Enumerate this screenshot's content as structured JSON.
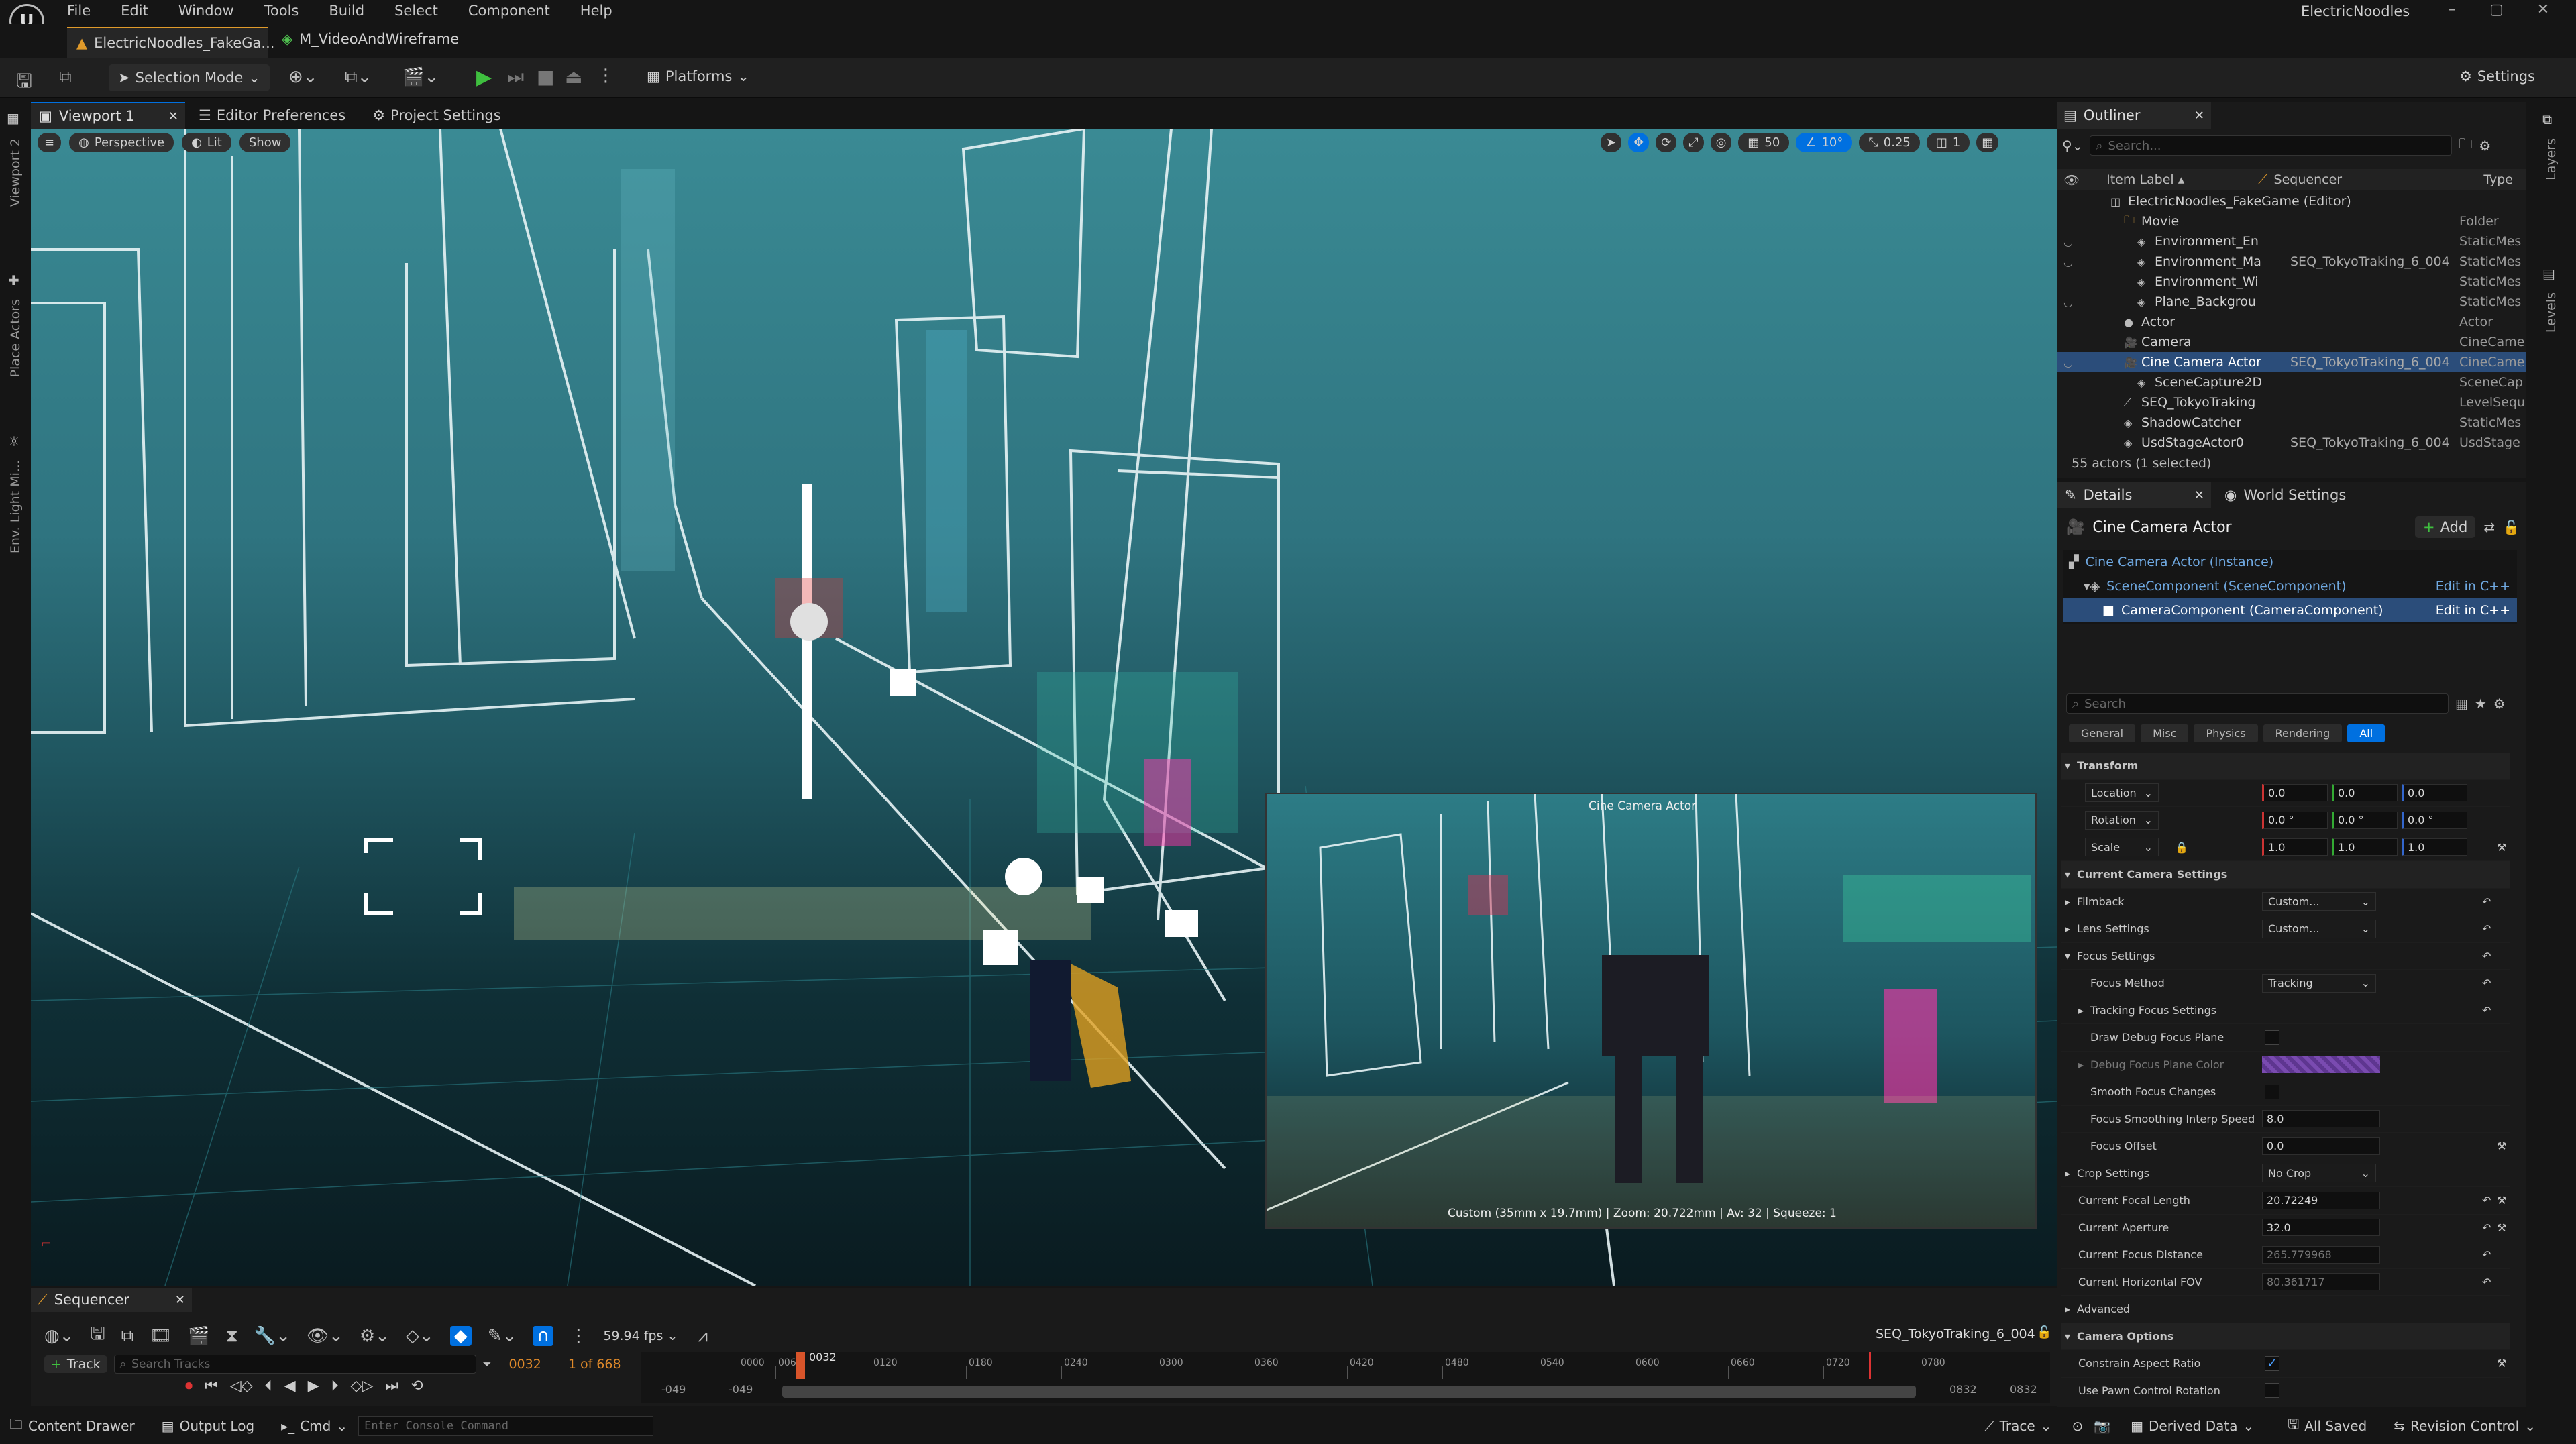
{
  "menu": [
    "File",
    "Edit",
    "Window",
    "Tools",
    "Build",
    "Select",
    "Component",
    "Help"
  ],
  "project_name": "ElectricNoodles",
  "tabs": [
    {
      "label": "ElectricNoodles_FakeGa..."
    },
    {
      "label": "M_VideoAndWireframe"
    }
  ],
  "toolbar": {
    "selection_mode": "Selection Mode",
    "platforms": "Platforms",
    "settings": "Settings"
  },
  "viewport_tabs": {
    "viewport": "Viewport 1",
    "editor_prefs": "Editor Preferences",
    "project_settings": "Project Settings"
  },
  "left_strip": {
    "viewport2": "Viewport 2",
    "place_actors": "Place Actors",
    "env_light": "Env. Light Mi..."
  },
  "right_strip": {
    "layers": "Layers",
    "levels": "Levels"
  },
  "viewport": {
    "perspective": "Perspective",
    "lit": "Lit",
    "show": "Show",
    "grid_snap": "50",
    "angle_snap": "10°",
    "scale_snap": "0.25",
    "camera_speed": "1",
    "pip_title": "Cine Camera Actor",
    "pip_footer": "Custom (35mm x 19.7mm) | Zoom: 20.722mm | Av: 32 | Squeeze: 1"
  },
  "outliner": {
    "title": "Outliner",
    "search_placeholder": "Search...",
    "col_label": "Item Label",
    "col_seq": "Sequencer",
    "col_type": "Type",
    "rows": [
      {
        "label": "ElectricNoodles_FakeGame (Editor)",
        "seq": "",
        "type": ""
      },
      {
        "label": "Movie",
        "seq": "",
        "type": "Folder"
      },
      {
        "label": "Environment_En",
        "seq": "",
        "type": "StaticMes"
      },
      {
        "label": "Environment_Ma",
        "seq": "SEQ_TokyoTraking_6_004",
        "type": "StaticMes"
      },
      {
        "label": "Environment_Wi",
        "seq": "",
        "type": "StaticMes"
      },
      {
        "label": "Plane_Backgrou",
        "seq": "",
        "type": "StaticMes"
      },
      {
        "label": "Actor",
        "seq": "",
        "type": "Actor"
      },
      {
        "label": "Camera",
        "seq": "",
        "type": "CineCame"
      },
      {
        "label": "Cine Camera Actor",
        "seq": "SEQ_TokyoTraking_6_004",
        "type": "CineCame"
      },
      {
        "label": "SceneCapture2D",
        "seq": "",
        "type": "SceneCap"
      },
      {
        "label": "SEQ_TokyoTraking",
        "seq": "",
        "type": "LevelSequ"
      },
      {
        "label": "ShadowCatcher",
        "seq": "",
        "type": "StaticMes"
      },
      {
        "label": "UsdStageActor0",
        "seq": "SEQ_TokyoTraking_6_004",
        "type": "UsdStage"
      }
    ],
    "status": "55 actors (1 selected)"
  },
  "details": {
    "tab": "Details",
    "world_tab": "World Settings",
    "actor_name": "Cine Camera Actor",
    "add": "Add",
    "instance": "Cine Camera Actor (Instance)",
    "scene_comp": "SceneComponent (SceneComponent)",
    "camera_comp": "CameraComponent (CameraComponent)",
    "edit_cpp": "Edit in C++",
    "search_placeholder": "Search",
    "filters": [
      "General",
      "Misc",
      "Physics",
      "Rendering",
      "All"
    ],
    "transform": "Transform",
    "location": "Location",
    "rotation": "Rotation",
    "scale": "Scale",
    "loc": [
      "0.0",
      "0.0",
      "0.0"
    ],
    "rot": [
      "0.0 °",
      "0.0 °",
      "0.0 °"
    ],
    "scl": [
      "1.0",
      "1.0",
      "1.0"
    ],
    "current_camera_settings": "Current Camera Settings",
    "filmback": "Filmback",
    "filmback_val": "Custom...",
    "lens": "Lens Settings",
    "lens_val": "Custom...",
    "focus": "Focus Settings",
    "focus_method": "Focus Method",
    "focus_method_val": "Tracking",
    "tracking_focus": "Tracking Focus Settings",
    "draw_debug": "Draw Debug Focus Plane",
    "debug_color": "Debug Focus Plane Color",
    "smooth": "Smooth Focus Changes",
    "smooth_speed": "Focus Smoothing Interp Speed",
    "smooth_speed_val": "8.0",
    "focus_offset": "Focus Offset",
    "focus_offset_val": "0.0",
    "crop": "Crop Settings",
    "crop_val": "No Crop",
    "focal_length": "Current Focal Length",
    "focal_length_val": "20.72249",
    "aperture": "Current Aperture",
    "aperture_val": "32.0",
    "focus_distance": "Current Focus Distance",
    "focus_distance_val": "265.779968",
    "hfov": "Current Horizontal FOV",
    "hfov_val": "80.361717",
    "advanced": "Advanced",
    "camera_options": "Camera Options",
    "constrain": "Constrain Aspect Ratio",
    "pawn_rot": "Use Pawn Control Rotation"
  },
  "sequencer": {
    "title": "Sequencer",
    "fps": "59.94 fps",
    "sequence_name": "SEQ_TokyoTraking_6_004",
    "track": "Track",
    "search_placeholder": "Search Tracks",
    "current_frame": "0032",
    "frame_count": "1 of 668",
    "playhead": "0032",
    "ticks": [
      "0060",
      "0120",
      "0180",
      "0240",
      "0300",
      "0360",
      "0420",
      "0480",
      "0540",
      "0600",
      "0660",
      "0720",
      "0780"
    ],
    "tick_left": "0000",
    "range_start": "-049",
    "range_start2": "-049",
    "range_end": "0832",
    "range_end2": "0832"
  },
  "statusbar": {
    "content_drawer": "Content Drawer",
    "output_log": "Output Log",
    "cmd": "Cmd",
    "console_placeholder": "Enter Console Command",
    "trace": "Trace",
    "derived": "Derived Data",
    "saved": "All Saved",
    "revision": "Revision Control"
  },
  "colors": {
    "accent": "#0070e0",
    "selected_row": "#2b4d7a",
    "play_green": "#3fbf3f",
    "bg": "#151515"
  }
}
